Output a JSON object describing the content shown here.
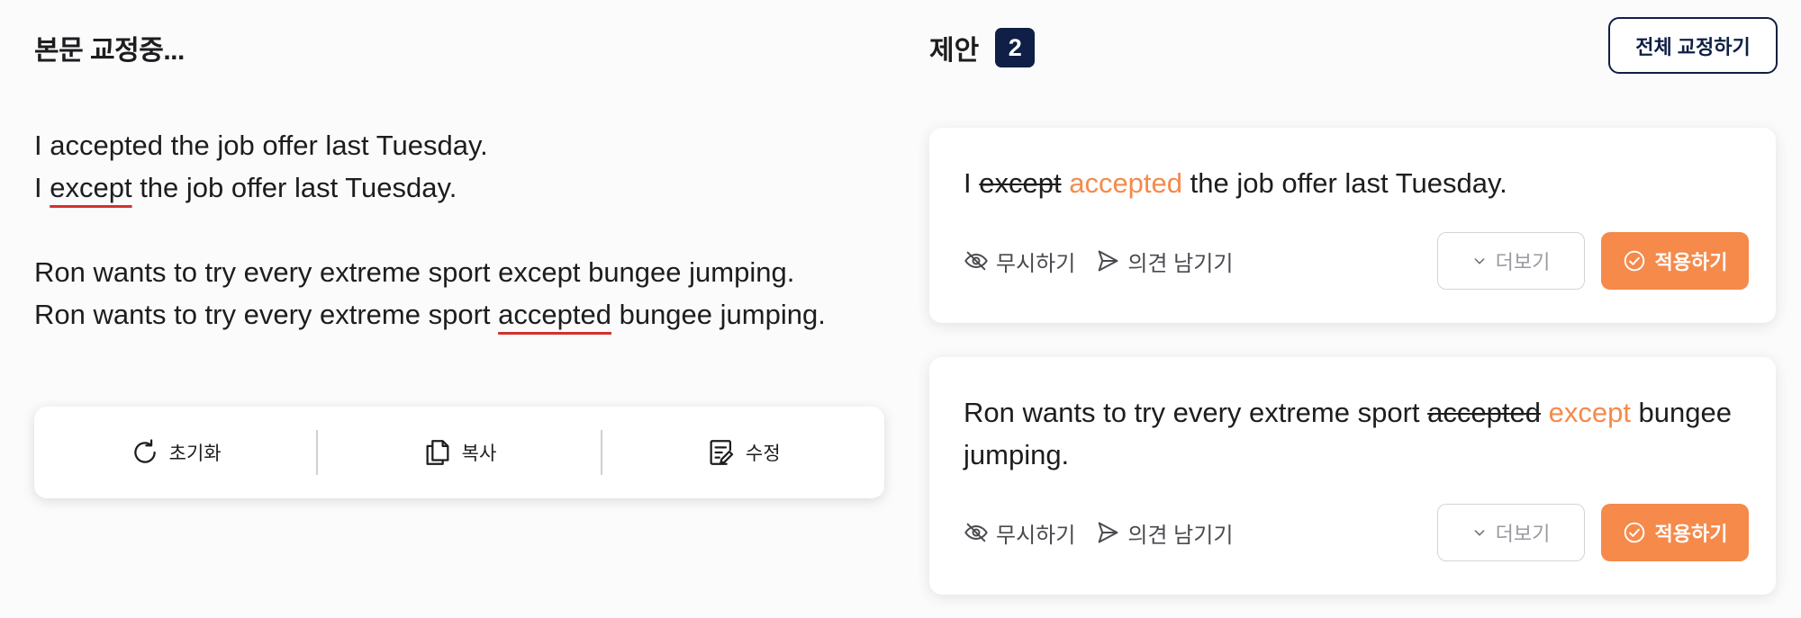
{
  "editor": {
    "title": "본문 교정중...",
    "paragraphs": [
      {
        "line1": "I accepted the job offer last Tuesday.",
        "line2_before": "I ",
        "line2_error": "except",
        "line2_after": " the job offer last Tuesday."
      },
      {
        "line1": "Ron wants to try every extreme sport except bungee jumping.",
        "line2_before": "Ron wants to try every extreme sport ",
        "line2_error": "accepted",
        "line2_after": " bungee jumping."
      }
    ],
    "toolbar": {
      "reset_label": "초기화",
      "copy_label": "복사",
      "edit_label": "수정"
    }
  },
  "suggestions": {
    "title": "제안",
    "count": "2",
    "fix_all_label": "전체 교정하기",
    "items": [
      {
        "before": "I ",
        "deleted": "except",
        "inserted": "accepted",
        "after": " the job offer last Tuesday.",
        "ignore_label": "무시하기",
        "feedback_label": "의견 남기기",
        "more_label": "더보기",
        "apply_label": "적용하기"
      },
      {
        "before": "Ron wants to try every extreme sport ",
        "deleted": "accepted",
        "inserted": "except",
        "after": " bungee jumping.",
        "ignore_label": "무시하기",
        "feedback_label": "의견 남기기",
        "more_label": "더보기",
        "apply_label": "적용하기"
      }
    ]
  },
  "colors": {
    "accent": "#f58a4b",
    "navy": "#0f1f45",
    "error_underline": "#d2322d"
  },
  "icons": [
    "reset-icon",
    "copy-icon",
    "edit-icon",
    "eye-off-icon",
    "send-icon",
    "chevron-down-icon",
    "check-circle-icon"
  ]
}
